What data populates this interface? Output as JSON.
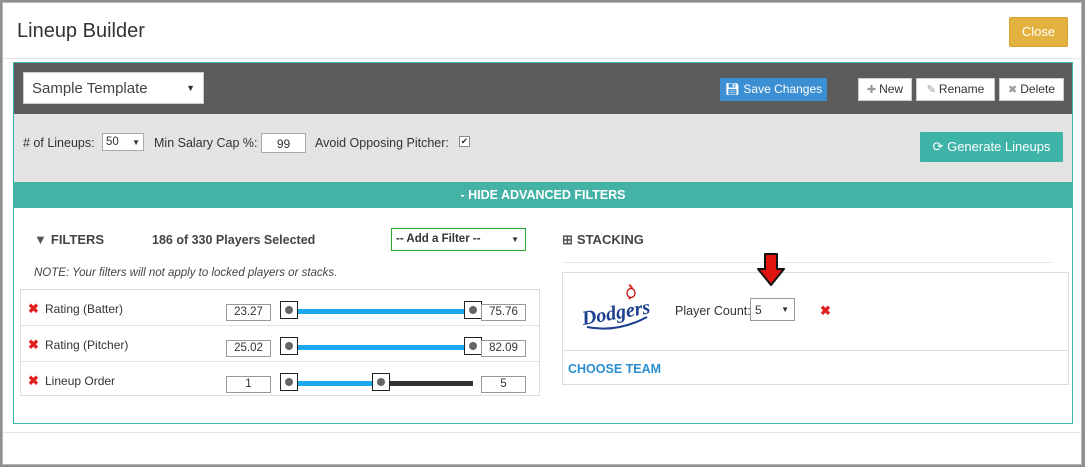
{
  "header": {
    "title": "Lineup Builder",
    "close_label": "Close"
  },
  "toolbar": {
    "template_value": "Sample Template",
    "save_label": "Save Changes",
    "new_label": "New",
    "rename_label": "Rename",
    "delete_label": "Delete"
  },
  "options": {
    "lineups_label": "# of Lineups:",
    "lineups_value": "50",
    "salary_label": "Min Salary Cap %:",
    "salary_value": "99",
    "pitcher_label": "Avoid Opposing Pitcher:",
    "pitcher_checked": "✔",
    "generate_label": "Generate Lineups"
  },
  "advanced": {
    "toggle_label": "- HIDE ADVANCED FILTERS"
  },
  "filters": {
    "title": "FILTERS",
    "selected_text": "186 of 330 Players Selected",
    "add_filter_label": "-- Add a Filter --",
    "note": "NOTE: Your filters will not apply to locked players or stacks.",
    "rows": [
      {
        "label": "Rating (Batter)",
        "min": "23.27",
        "max": "75.76",
        "range_min": 0,
        "range_max": 1
      },
      {
        "label": "Rating (Pitcher)",
        "min": "25.02",
        "max": "82.09",
        "range_min": 0,
        "range_max": 1
      },
      {
        "label": "Lineup Order",
        "min": "1",
        "max": "5",
        "range_min": 0,
        "range_max": 0.5
      }
    ]
  },
  "stacking": {
    "title": "STACKING",
    "team_logo_text": "Dodgers",
    "player_count_label": "Player Count:",
    "player_count_value": "5",
    "choose_team_label": "CHOOSE TEAM"
  },
  "colors": {
    "accent_teal": "#45b2a6",
    "save_blue": "#3d8fd3",
    "close_gold": "#e3b13e",
    "slider_blue": "#1ba8ec",
    "remove_red": "#e02020"
  },
  "icons": [
    "save-icon",
    "plus-icon",
    "edit-icon",
    "times-icon",
    "refresh-icon",
    "filter-icon",
    "sitemap-icon",
    "arrow-down-icon"
  ]
}
